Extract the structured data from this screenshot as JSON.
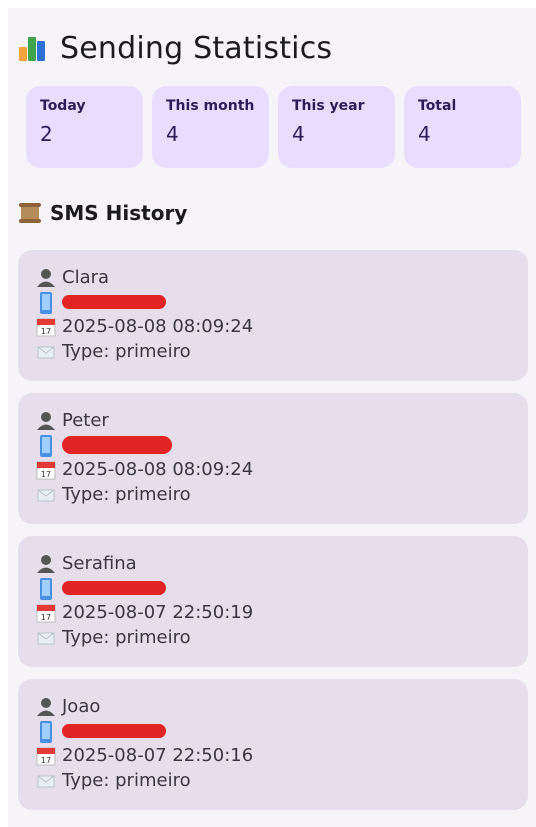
{
  "app": {
    "title": "Sending Statistics",
    "header_icon": "bar-chart-icon"
  },
  "stats": [
    {
      "label": "Today",
      "value": "2"
    },
    {
      "label": "This month",
      "value": "4"
    },
    {
      "label": "This year",
      "value": "4"
    },
    {
      "label": "Total",
      "value": "4"
    }
  ],
  "history": {
    "title": "SMS History",
    "icon": "scroll-icon",
    "items": [
      {
        "name": "Clara",
        "datetime": "2025-08-08 08:09:24",
        "type": "Type: primeiro"
      },
      {
        "name": "Peter",
        "datetime": "2025-08-08 08:09:24",
        "type": "Type: primeiro"
      },
      {
        "name": "Serafina",
        "datetime": "2025-08-07 22:50:19",
        "type": "Type: primeiro"
      },
      {
        "name": "Joao",
        "datetime": "2025-08-07 22:50:16",
        "type": "Type: primeiro"
      }
    ]
  },
  "colors": {
    "stat_bg": "#e9ddff",
    "card_bg": "#e6dfeb",
    "redaction": "#e32424"
  }
}
